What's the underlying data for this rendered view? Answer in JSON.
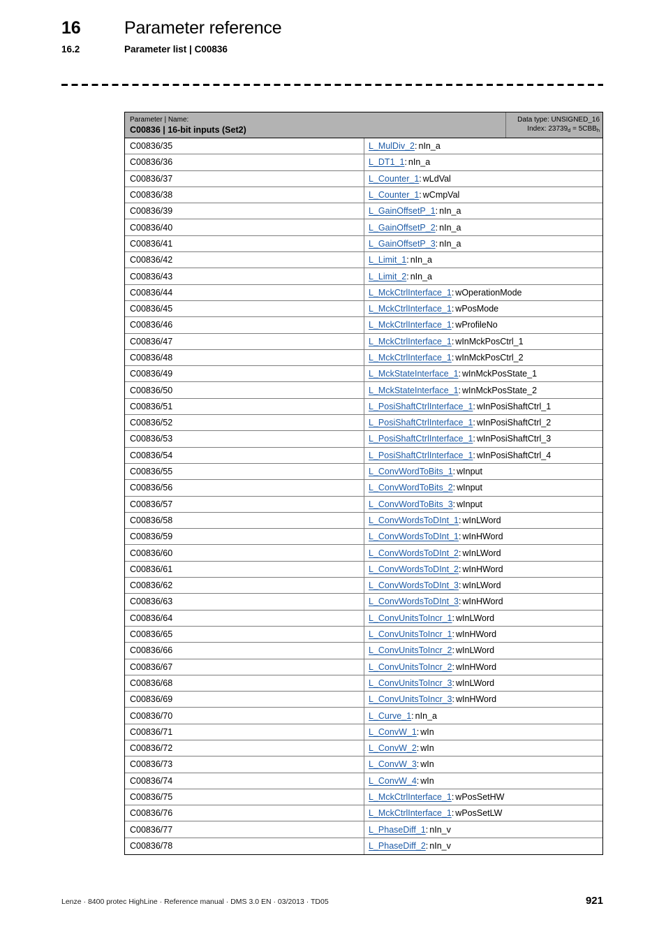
{
  "header": {
    "chapter_number": "16",
    "chapter_title": "Parameter reference",
    "section_number": "16.2",
    "section_title": "Parameter list | C00836"
  },
  "table": {
    "head": {
      "caption": "Parameter | Name:",
      "title": "C00836 | 16-bit inputs (Set2)",
      "data_type_label": "Data type: UNSIGNED_16",
      "index_prefix": "Index: 23739",
      "index_sub_dec": "d",
      "index_equals": " = 5CBB",
      "index_sub_hex": "h"
    },
    "rows": [
      {
        "param": "C00836/35",
        "link": "L_MulDiv_2",
        "member": "nIn_a"
      },
      {
        "param": "C00836/36",
        "link": "L_DT1_1",
        "member": "nIn_a"
      },
      {
        "param": "C00836/37",
        "link": "L_Counter_1",
        "member": "wLdVal"
      },
      {
        "param": "C00836/38",
        "link": "L_Counter_1",
        "member": "wCmpVal"
      },
      {
        "param": "C00836/39",
        "link": "L_GainOffsetP_1",
        "member": "nIn_a"
      },
      {
        "param": "C00836/40",
        "link": "L_GainOffsetP_2",
        "member": "nIn_a"
      },
      {
        "param": "C00836/41",
        "link": "L_GainOffsetP_3",
        "member": "nIn_a"
      },
      {
        "param": "C00836/42",
        "link": "L_Limit_1",
        "member": "nIn_a"
      },
      {
        "param": "C00836/43",
        "link": "L_Limit_2",
        "member": "nIn_a"
      },
      {
        "param": "C00836/44",
        "link": "L_MckCtrlInterface_1",
        "member": "wOperationMode"
      },
      {
        "param": "C00836/45",
        "link": "L_MckCtrlInterface_1",
        "member": "wPosMode"
      },
      {
        "param": "C00836/46",
        "link": "L_MckCtrlInterface_1",
        "member": "wProfileNo"
      },
      {
        "param": "C00836/47",
        "link": "L_MckCtrlInterface_1",
        "member": "wInMckPosCtrl_1"
      },
      {
        "param": "C00836/48",
        "link": "L_MckCtrlInterface_1",
        "member": "wInMckPosCtrl_2"
      },
      {
        "param": "C00836/49",
        "link": "L_MckStateInterface_1",
        "member": "wInMckPosState_1"
      },
      {
        "param": "C00836/50",
        "link": "L_MckStateInterface_1",
        "member": "wInMckPosState_2"
      },
      {
        "param": "C00836/51",
        "link": "L_PosiShaftCtrlInterface_1",
        "member": "wInPosiShaftCtrl_1"
      },
      {
        "param": "C00836/52",
        "link": "L_PosiShaftCtrlInterface_1",
        "member": "wInPosiShaftCtrl_2"
      },
      {
        "param": "C00836/53",
        "link": "L_PosiShaftCtrlInterface_1",
        "member": "wInPosiShaftCtrl_3"
      },
      {
        "param": "C00836/54",
        "link": "L_PosiShaftCtrlInterface_1",
        "member": "wInPosiShaftCtrl_4"
      },
      {
        "param": "C00836/55",
        "link": "L_ConvWordToBits_1",
        "member": "wInput"
      },
      {
        "param": "C00836/56",
        "link": "L_ConvWordToBits_2",
        "member": "wInput"
      },
      {
        "param": "C00836/57",
        "link": "L_ConvWordToBits_3",
        "member": "wInput"
      },
      {
        "param": "C00836/58",
        "link": "L_ConvWordsToDInt_1",
        "member": "wInLWord"
      },
      {
        "param": "C00836/59",
        "link": "L_ConvWordsToDInt_1",
        "member": "wInHWord"
      },
      {
        "param": "C00836/60",
        "link": "L_ConvWordsToDInt_2",
        "member": "wInLWord"
      },
      {
        "param": "C00836/61",
        "link": "L_ConvWordsToDInt_2",
        "member": "wInHWord"
      },
      {
        "param": "C00836/62",
        "link": "L_ConvWordsToDInt_3",
        "member": "wInLWord"
      },
      {
        "param": "C00836/63",
        "link": "L_ConvWordsToDInt_3",
        "member": "wInHWord"
      },
      {
        "param": "C00836/64",
        "link": "L_ConvUnitsToIncr_1",
        "member": "wInLWord"
      },
      {
        "param": "C00836/65",
        "link": "L_ConvUnitsToIncr_1",
        "member": "wInHWord"
      },
      {
        "param": "C00836/66",
        "link": "L_ConvUnitsToIncr_2",
        "member": "wInLWord"
      },
      {
        "param": "C00836/67",
        "link": "L_ConvUnitsToIncr_2",
        "member": "wInHWord"
      },
      {
        "param": "C00836/68",
        "link": "L_ConvUnitsToIncr_3",
        "member": "wInLWord"
      },
      {
        "param": "C00836/69",
        "link": "L_ConvUnitsToIncr_3",
        "member": "wInHWord"
      },
      {
        "param": "C00836/70",
        "link": "L_Curve_1",
        "member": "nIn_a"
      },
      {
        "param": "C00836/71",
        "link": "L_ConvW_1",
        "member": "wIn"
      },
      {
        "param": "C00836/72",
        "link": "L_ConvW_2",
        "member": "wIn"
      },
      {
        "param": "C00836/73",
        "link": "L_ConvW_3",
        "member": "wIn"
      },
      {
        "param": "C00836/74",
        "link": "L_ConvW_4",
        "member": "wIn"
      },
      {
        "param": "C00836/75",
        "link": "L_MckCtrlInterface_1",
        "member": "wPosSetHW"
      },
      {
        "param": "C00836/76",
        "link": "L_MckCtrlInterface_1",
        "member": "wPosSetLW"
      },
      {
        "param": "C00836/77",
        "link": "L_PhaseDiff_1",
        "member": "nIn_v"
      },
      {
        "param": "C00836/78",
        "link": "L_PhaseDiff_2",
        "member": "nIn_v"
      }
    ],
    "row_separator": ":"
  },
  "footer": {
    "text": "Lenze · 8400 protec HighLine · Reference manual · DMS 3.0 EN · 03/2013 · TD05",
    "page_number": "921"
  },
  "colors": {
    "link": "#1d5ba6",
    "table_header_bg": "#b3b3b3",
    "row_border": "#7d7d7d"
  }
}
